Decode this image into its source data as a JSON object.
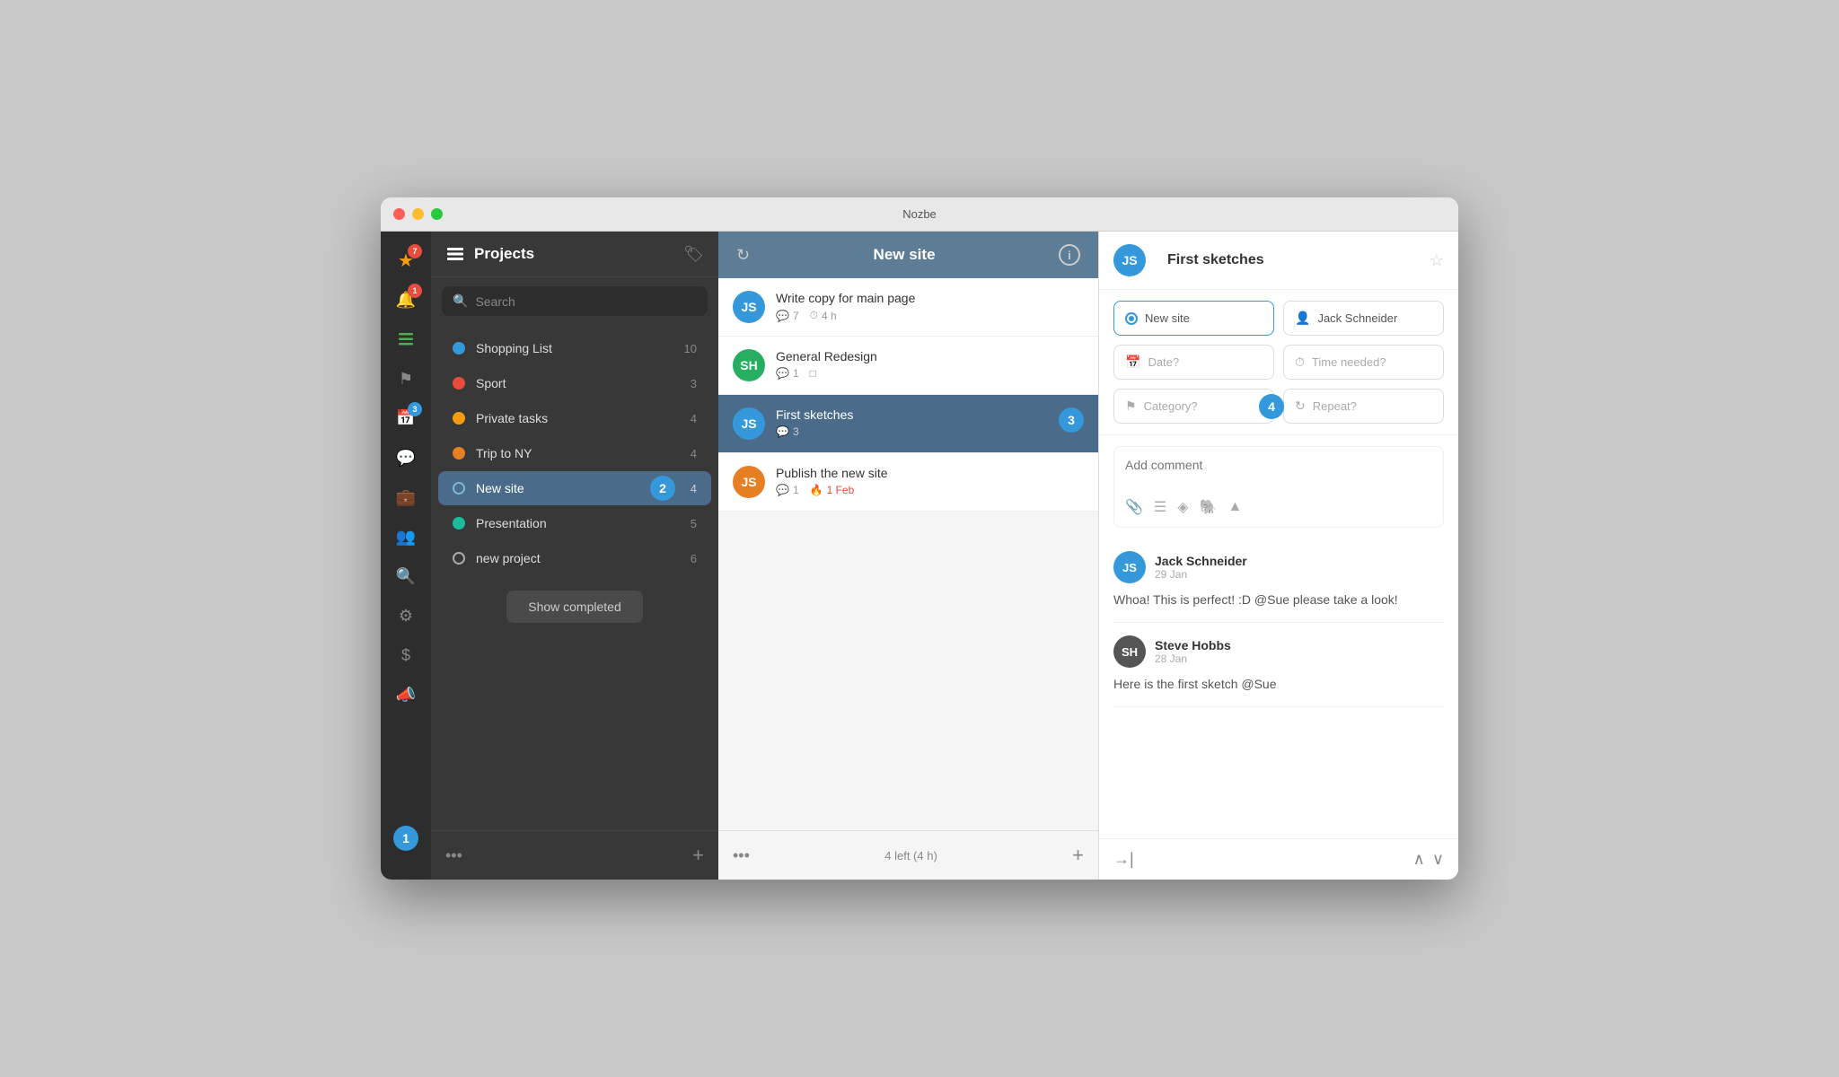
{
  "app": {
    "title": "Nozbe"
  },
  "sidebar": {
    "title": "Projects",
    "search_placeholder": "Search",
    "projects": [
      {
        "id": "shopping",
        "name": "Shopping List",
        "count": 10,
        "dot": "blue",
        "active": false
      },
      {
        "id": "sport",
        "name": "Sport",
        "count": 3,
        "dot": "red",
        "active": false
      },
      {
        "id": "private",
        "name": "Private tasks",
        "count": 4,
        "dot": "yellow",
        "active": false
      },
      {
        "id": "trip",
        "name": "Trip to NY",
        "count": 4,
        "dot": "orange",
        "active": false
      },
      {
        "id": "newsite",
        "name": "New site",
        "count": 4,
        "dot": "blue-ring",
        "active": true
      },
      {
        "id": "presentation",
        "name": "Presentation",
        "count": 5,
        "dot": "teal",
        "active": false
      },
      {
        "id": "newproject",
        "name": "new project",
        "count": 6,
        "dot": "white",
        "active": false
      }
    ],
    "show_completed": "Show completed",
    "footer_dots": "•••",
    "footer_plus": "+"
  },
  "task_panel": {
    "header_title": "New site",
    "tasks": [
      {
        "id": "t1",
        "title": "Write copy for main page",
        "comments": 7,
        "time": "4 h",
        "avatar_initials": "JS",
        "avatar_color": "blue",
        "selected": false
      },
      {
        "id": "t2",
        "title": "General Redesign",
        "comments": 1,
        "has_comment_icon": true,
        "avatar_initials": "SH",
        "avatar_color": "green",
        "selected": false
      },
      {
        "id": "t3",
        "title": "First sketches",
        "comments": 3,
        "avatar_initials": "JS",
        "avatar_color": "blue",
        "selected": true
      },
      {
        "id": "t4",
        "title": "Publish the new site",
        "comments": 1,
        "due_date": "1 Feb",
        "avatar_initials": "JS",
        "avatar_color": "orange",
        "selected": false
      }
    ],
    "footer_dots": "•••",
    "footer_info": "4 left (4 h)",
    "footer_plus": "+"
  },
  "detail_panel": {
    "task_title": "First sketches",
    "project_name": "New site",
    "assignee": "Jack Schneider",
    "date_placeholder": "Date?",
    "time_placeholder": "Time needed?",
    "category_placeholder": "Category?",
    "repeat_placeholder": "Repeat?",
    "comment_placeholder": "Add comment",
    "comments": [
      {
        "id": "c1",
        "author": "Jack Schneider",
        "date": "29 Jan",
        "text": "Whoa! This is perfect! :D @Sue please take a look!",
        "avatar_initials": "JS",
        "avatar_color": "jack"
      },
      {
        "id": "c2",
        "author": "Steve Hobbs",
        "date": "28 Jan",
        "text": "Here is the first sketch @Sue",
        "avatar_initials": "SH",
        "avatar_color": "steve"
      }
    ]
  },
  "icon_bar": {
    "icons": [
      {
        "id": "star",
        "symbol": "★",
        "badge": 7,
        "badge_color": "red"
      },
      {
        "id": "notification",
        "symbol": "🔔",
        "badge": 1,
        "badge_color": "red"
      },
      {
        "id": "projects",
        "symbol": "≡",
        "active": true
      },
      {
        "id": "flag",
        "symbol": "⚑",
        "badge": null
      },
      {
        "id": "calendar",
        "symbol": "📅",
        "badge": 3,
        "badge_color": "blue"
      },
      {
        "id": "chat",
        "symbol": "💬",
        "badge": null
      },
      {
        "id": "briefcase",
        "symbol": "💼",
        "badge": null
      },
      {
        "id": "people",
        "symbol": "👥",
        "badge": null
      },
      {
        "id": "search",
        "symbol": "🔍",
        "badge": null
      },
      {
        "id": "settings",
        "symbol": "⚙",
        "badge": null
      },
      {
        "id": "dollar",
        "symbol": "$",
        "badge": null
      },
      {
        "id": "megaphone",
        "symbol": "📣",
        "badge": null
      }
    ]
  },
  "step_badges": [
    "1",
    "2",
    "3",
    "4"
  ]
}
